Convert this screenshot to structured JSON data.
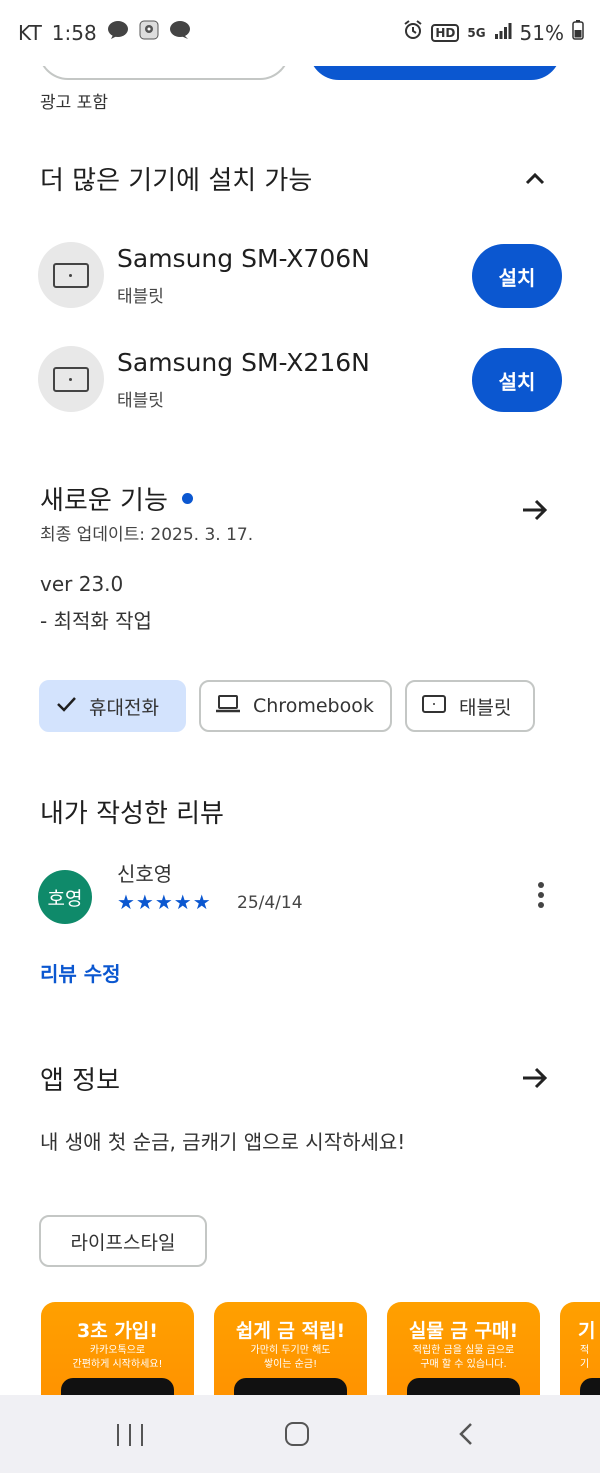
{
  "status_bar": {
    "carrier": "KT",
    "time": "1:58",
    "battery": "51%",
    "network": "5G",
    "hd_label": "HD"
  },
  "ad_label": "광고 포함",
  "more_devices": {
    "title": "더 많은 기기에 설치 가능",
    "devices": [
      {
        "name": "Samsung SM-X706N",
        "type": "태블릿",
        "button": "설치"
      },
      {
        "name": "Samsung SM-X216N",
        "type": "태블릿",
        "button": "설치"
      }
    ]
  },
  "whats_new": {
    "title": "새로운 기능",
    "updated": "최종 업데이트: 2025. 3. 17.",
    "version": "ver 23.0",
    "notes": "- 최적화 작업"
  },
  "device_chips": [
    {
      "label": "휴대전화",
      "selected": true
    },
    {
      "label": "Chromebook",
      "selected": false
    },
    {
      "label": "태블릿",
      "selected": false
    }
  ],
  "my_review": {
    "title": "내가 작성한 리뷰",
    "avatar_text": "호영",
    "reviewer": "신호영",
    "stars": "★★★★★",
    "rating": 5,
    "date": "25/4/14",
    "edit_label": "리뷰 수정"
  },
  "app_info": {
    "title": "앱 정보",
    "description": "내 생애 첫 순금, 금캐기 앱으로 시작하세요!",
    "category": "라이프스타일"
  },
  "screenshots": [
    {
      "title": "3초 가입!",
      "subtitle_1": "카카오톡으로",
      "subtitle_2": "간편하게 시작하세요!"
    },
    {
      "title": "쉽게 금 적립!",
      "subtitle_1": "가만히 두기만 해도",
      "subtitle_2": "쌓이는 순금!"
    },
    {
      "title": "실물 금 구매!",
      "subtitle_1": "적립한 금을 실물 금으로",
      "subtitle_2": "구매 할 수 있습니다."
    },
    {
      "title": "기",
      "subtitle_1": "적",
      "subtitle_2": "기"
    }
  ],
  "colors": {
    "accent": "#0b57d0",
    "chip_selected": "#d3e3fd",
    "avatar": "#0f8a6a",
    "screenshot_bg": "#ff9800"
  }
}
